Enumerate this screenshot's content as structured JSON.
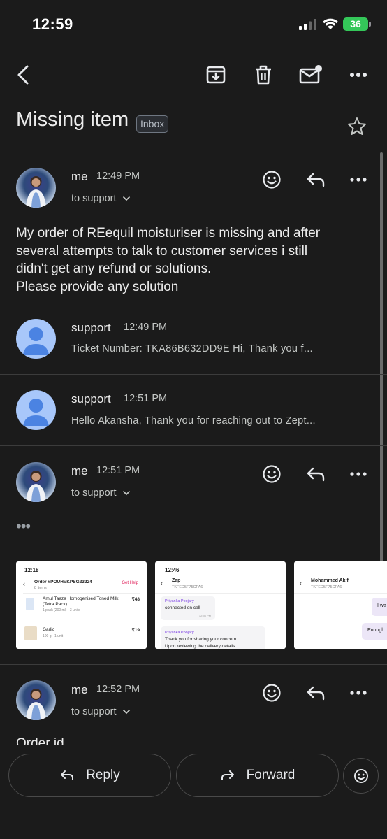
{
  "status_bar": {
    "time": "12:59",
    "battery": "36"
  },
  "subject": "Missing item",
  "label": "Inbox",
  "messages": [
    {
      "sender": "me",
      "time": "12:49 PM",
      "to": "to support",
      "body": [
        "My order of REequil moisturiser is missing and after",
        "several attempts to talk to customer services i still",
        "didn't get any refund or solutions.",
        "Please provide any solution"
      ]
    },
    {
      "sender": "support",
      "time": "12:49 PM",
      "snippet": "Ticket Number: TKA86B632DD9E Hi, Thank you f..."
    },
    {
      "sender": "support",
      "time": "12:51 PM",
      "snippet": "Hello Akansha, Thank you for reaching out to Zept..."
    },
    {
      "sender": "me",
      "time": "12:51 PM",
      "to": "to support",
      "collapsed": "•••"
    },
    {
      "sender": "me",
      "time": "12:52 PM",
      "to": "to support",
      "preview": "Order id"
    }
  ],
  "attachments": [
    {
      "time": "12:18",
      "title": "Order #POUHVKPSG23224",
      "subtitle": "8 items",
      "help": "Get Help",
      "item1": "Amul Taaza Homogenised Toned Milk (Tetra Pack)",
      "item1_meta": "1 pack (200 ml) · 3 units",
      "item1_price": "₹48",
      "item2": "Garlic",
      "item2_meta": "100 g · 1 unit",
      "item2_price": "₹19"
    },
    {
      "time": "12:46",
      "title": "Zap",
      "subtitle": "TKFED5F75CFA6",
      "agent": "Priyanka Poojary",
      "line1": "connected on call",
      "stamp": "12:36 PM",
      "agent2": "Priyanka Poojary",
      "line2": "Thank you for sharing your concern.",
      "line3": "Upon reviewing the delivery details"
    },
    {
      "title": "Mohammed Akif",
      "subtitle": "TKFED5F75CFA6",
      "bubble1": "I wa",
      "bubble2": "Enough"
    }
  ],
  "bottom": {
    "reply": "Reply",
    "forward": "Forward"
  }
}
